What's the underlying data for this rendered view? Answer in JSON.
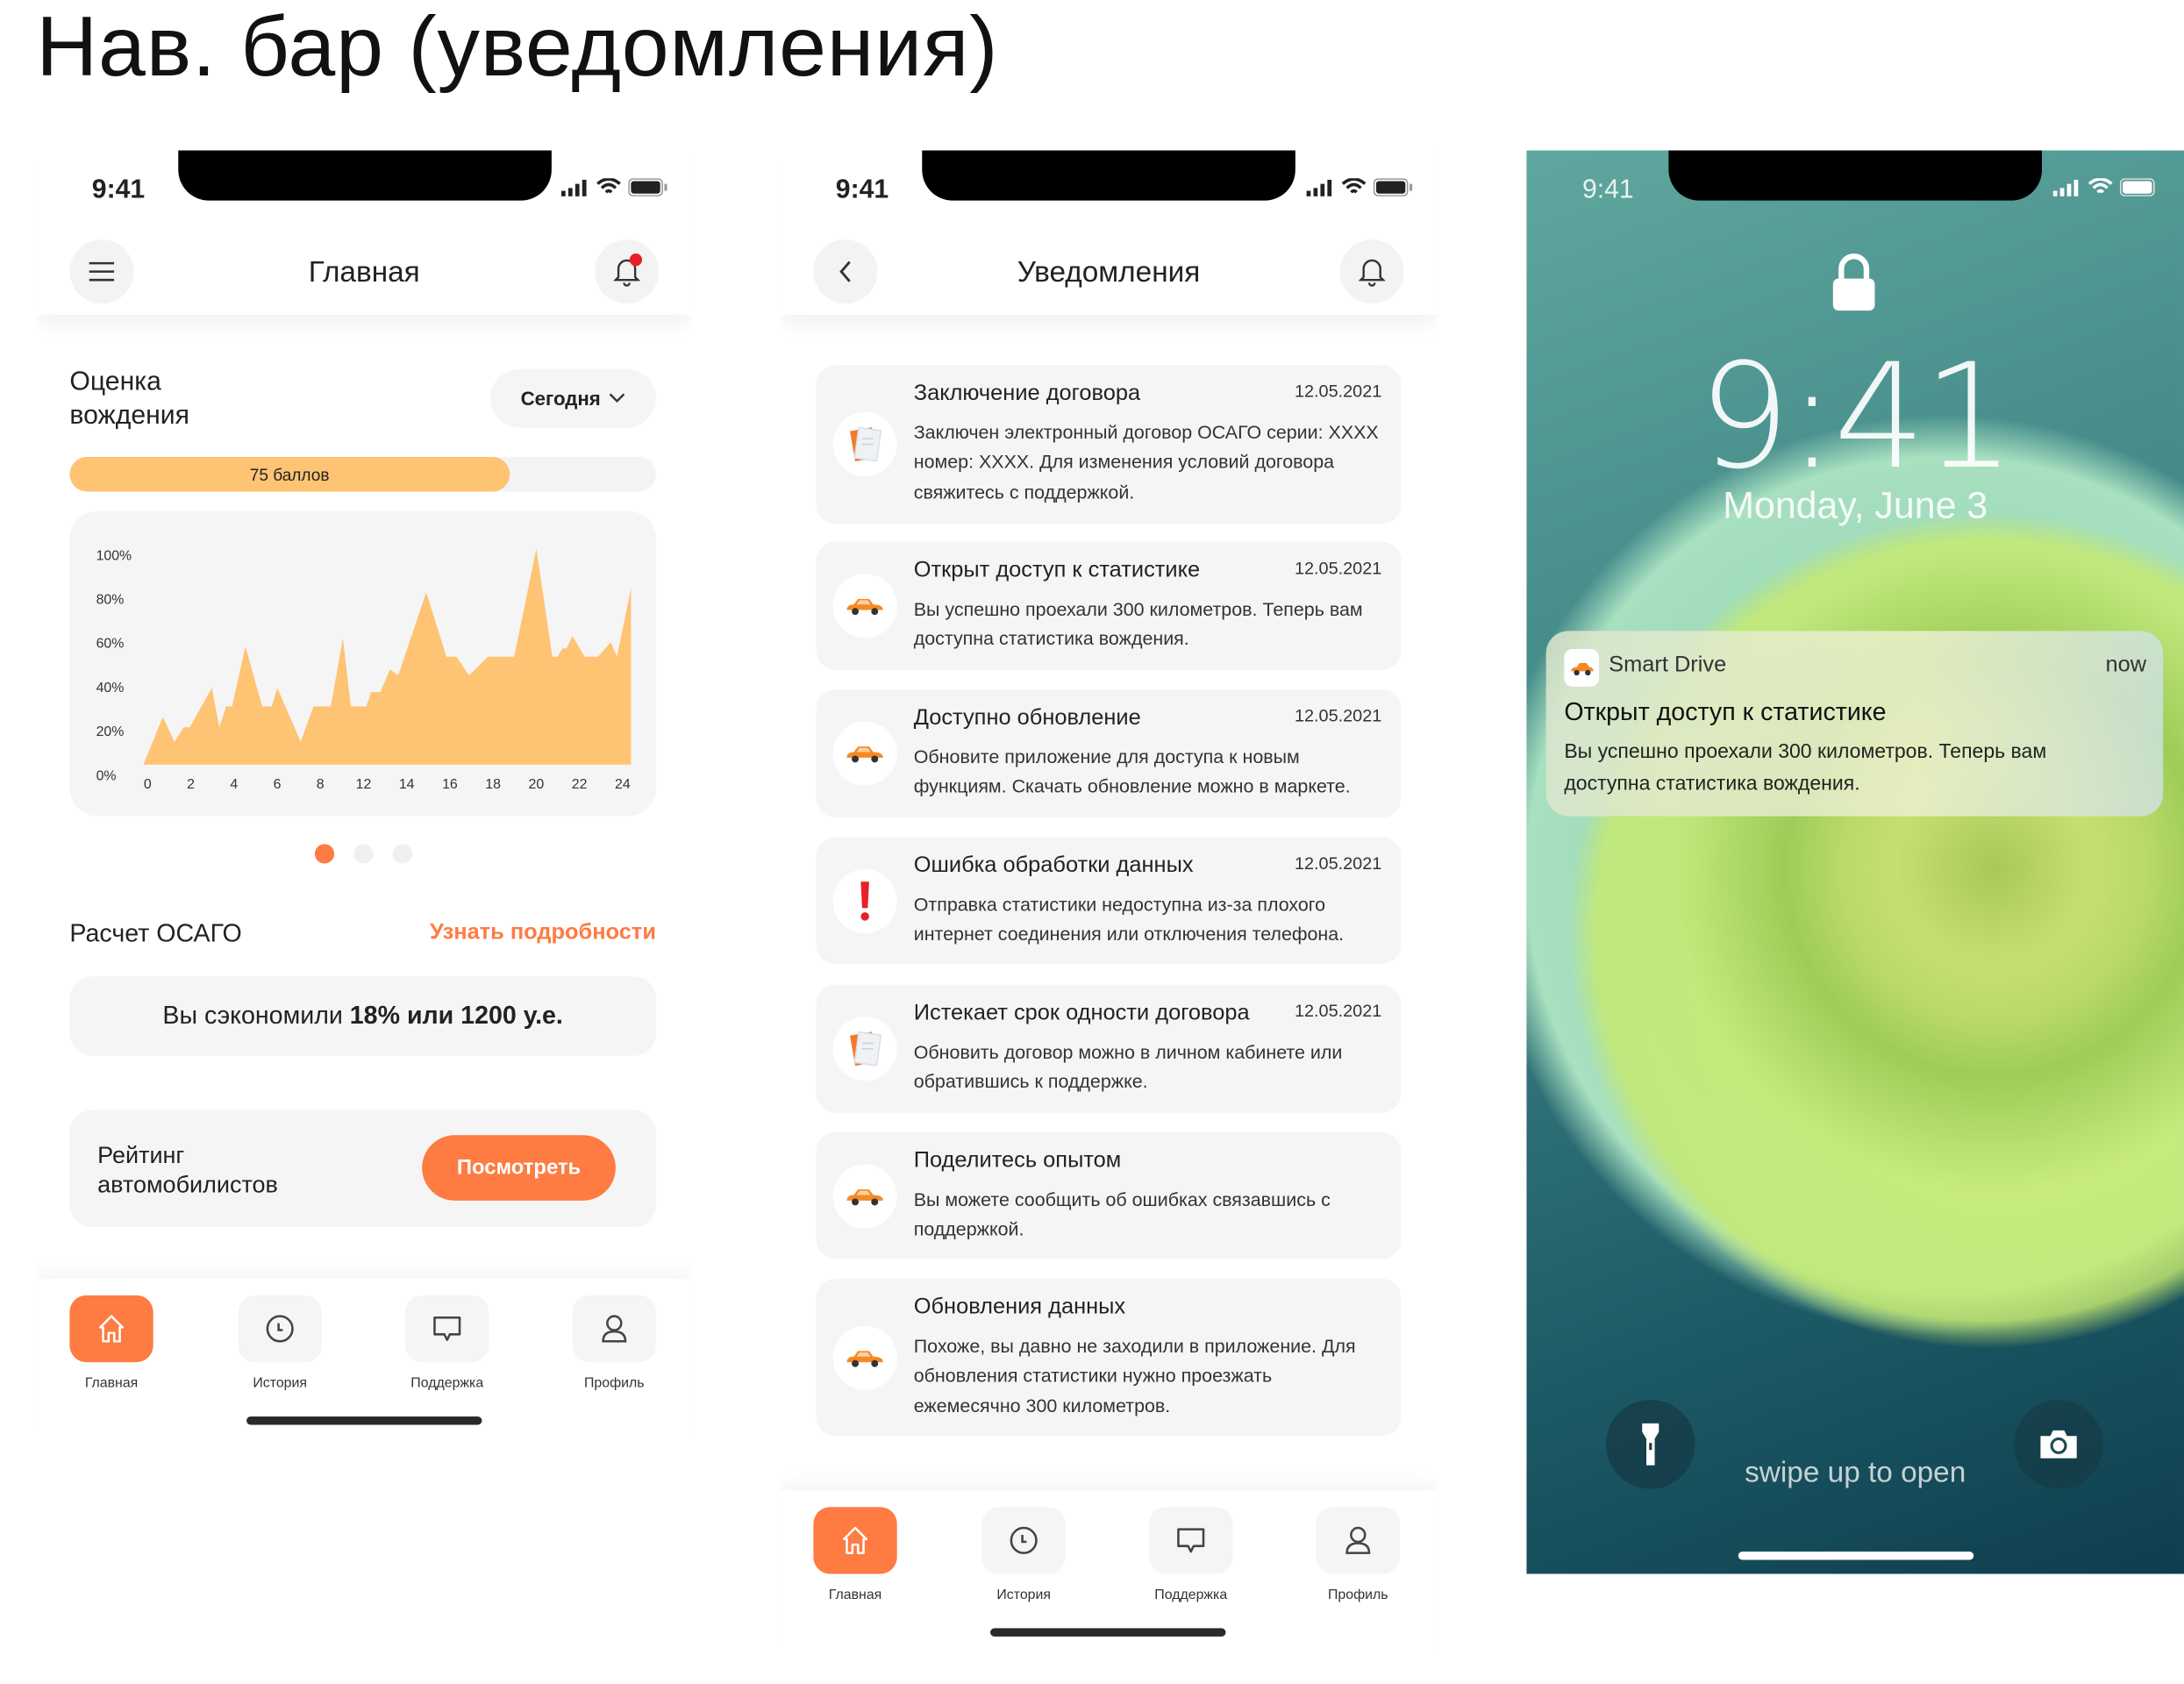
{
  "page_title": "Нав. бар (уведомления)",
  "status": {
    "time": "9:41"
  },
  "home_screen": {
    "title": "Главная",
    "rating_title": "Оценка вождения",
    "period_selector": "Сегодня",
    "score_label": "75 баллов",
    "score_fraction": 0.75,
    "carousel": {
      "pages": 3,
      "active": 0
    },
    "osago_title": "Расчет ОСАГО",
    "osago_link": "Узнать подробности",
    "savings_prefix": "Вы сэкономили ",
    "savings_value": "18% или 1200 у.е.",
    "ranking_label": "Рейтинг автомобилистов",
    "ranking_button": "Посмотреть"
  },
  "chart_data": {
    "type": "area",
    "title": "",
    "xlabel": "",
    "ylabel": "",
    "x_tick_labels": [
      "0",
      "2",
      "4",
      "6",
      "8",
      "12",
      "14",
      "16",
      "18",
      "20",
      "22",
      "24"
    ],
    "y_tick_labels": [
      "0%",
      "20%",
      "40%",
      "60%",
      "80%",
      "100%"
    ],
    "ylim": [
      0,
      100
    ],
    "xlim": [
      0,
      24
    ],
    "color": "#ffc374",
    "x": [
      0,
      0.95,
      1.53,
      1.98,
      2.28,
      3.37,
      3.73,
      4.07,
      4.36,
      5.02,
      5.85,
      6.31,
      6.59,
      7.74,
      8.37,
      9.22,
      9.82,
      10.21,
      10.97,
      11.21,
      11.66,
      12.14,
      12.54,
      13.92,
      14.92,
      15.41,
      16.03,
      16.96,
      18.25,
      19.34,
      20.13,
      20.39,
      20.63,
      20.83,
      21.12,
      21.72,
      22.37,
      23.01,
      23.31,
      24
    ],
    "y": [
      0,
      23,
      11,
      18,
      18,
      37,
      18,
      28,
      28,
      57,
      28,
      28,
      37,
      11,
      28,
      28,
      61,
      28,
      28,
      35,
      35,
      46,
      43,
      83,
      52,
      52,
      43,
      52,
      52,
      104,
      52,
      52,
      56,
      56,
      62,
      52,
      52,
      59,
      52,
      85
    ]
  },
  "notifications_screen": {
    "title": "Уведомления",
    "items": [
      {
        "icon": "document-icon",
        "title": "Заключение договора",
        "date": "12.05.2021",
        "body": "Заключен электронный договор ОСАГО серии: XXXX номер: XXXX. Для изменения условий договора свяжитесь с поддержкой."
      },
      {
        "icon": "car-icon",
        "title": "Открыт доступ к статистике",
        "date": "12.05.2021",
        "body": "Вы успешно проехали 300 километров. Теперь вам доступна статистика вождения."
      },
      {
        "icon": "car-icon",
        "title": "Доступно обновление",
        "date": "12.05.2021",
        "body": "Обновите приложение для доступа к новым функциям. Скачать обновление можно в маркете."
      },
      {
        "icon": "exclamation-icon",
        "title": "Ошибка обработки данных",
        "date": "12.05.2021",
        "body": "Отправка статистики недоступна из-за плохого интернет соединения или отключения телефона."
      },
      {
        "icon": "document-icon",
        "title": "Истекает срок одности договора",
        "date": "12.05.2021",
        "body": "Обновить договор можно в личном кабинете или обратившись к поддержке."
      },
      {
        "icon": "car-icon",
        "title": "Поделитесь опытом",
        "date": "",
        "body": "Вы можете сообщить об ошибках связавшись с поддержкой."
      },
      {
        "icon": "car-icon",
        "title": "Обновления данных",
        "date": "",
        "body": "Похоже, вы давно не заходили в приложение. Для обновления статистики нужно проезжать ежемесячно 300 километров."
      }
    ]
  },
  "tabs": [
    {
      "label": "Главная",
      "icon": "home-icon"
    },
    {
      "label": "История",
      "icon": "clock-icon"
    },
    {
      "label": "Поддержка",
      "icon": "chat-icon"
    },
    {
      "label": "Профиль",
      "icon": "user-icon"
    }
  ],
  "lock_screen": {
    "time": "9:41",
    "date": "Monday, June 3",
    "notification": {
      "app": "Smart Drive",
      "when": "now",
      "title": "Открыт доступ к статистике",
      "body": "Вы успешно проехали 300 километров. Теперь вам доступна статистика вождения."
    },
    "hint": "swipe up to open"
  },
  "colors": {
    "accent": "#fe7b42",
    "score": "#ffc374",
    "card": "#f5f5f5",
    "error": "#e8202a"
  }
}
